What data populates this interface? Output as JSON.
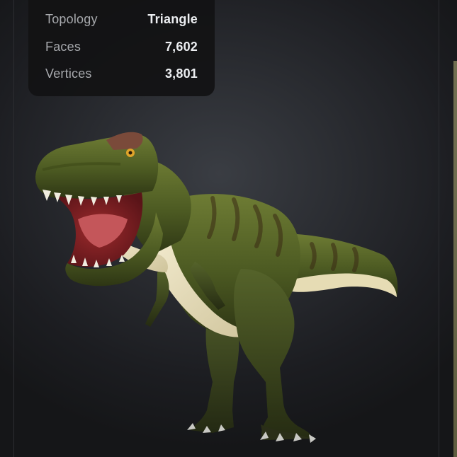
{
  "viewer": {
    "stats": [
      {
        "label": "Topology",
        "value": "Triangle"
      },
      {
        "label": "Faces",
        "value": "7,602"
      },
      {
        "label": "Vertices",
        "value": "3,801"
      }
    ],
    "model": {
      "icon": "tyrannosaurus-3d-model"
    }
  },
  "colors": {
    "background": "#232529",
    "panel": "#121214",
    "label": "#a7a9ad",
    "value": "#eceef1",
    "model_skin": "#5a6a2a",
    "model_belly": "#efe6c6"
  }
}
